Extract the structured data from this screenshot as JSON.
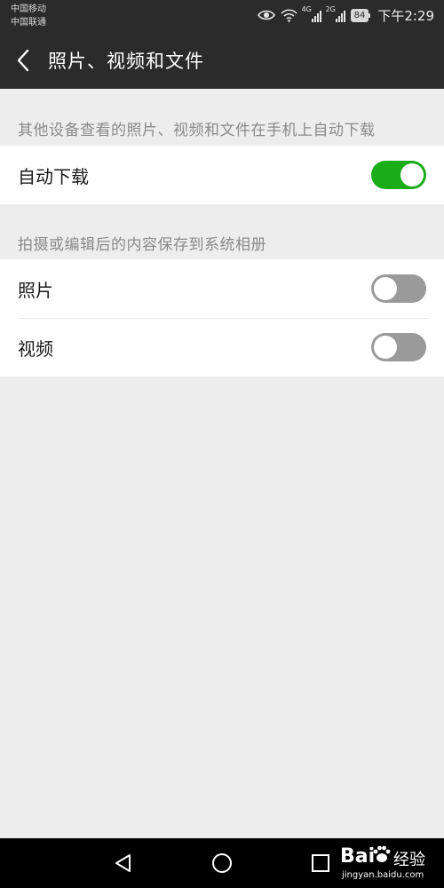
{
  "status_bar": {
    "carrier1": "中国移动",
    "carrier2": "中国联通",
    "net1": "4G",
    "net2": "2G",
    "battery": "84",
    "time": "下午2:29"
  },
  "header": {
    "title": "照片、视频和文件"
  },
  "sections": [
    {
      "caption": "其他设备查看的照片、视频和文件在手机上自动下载",
      "items": [
        {
          "label": "自动下载",
          "enabled": true
        }
      ]
    },
    {
      "caption": "拍摄或编辑后的内容保存到系统相册",
      "items": [
        {
          "label": "照片",
          "enabled": false
        },
        {
          "label": "视频",
          "enabled": false
        }
      ]
    }
  ],
  "watermark": {
    "brand_a": "Bai",
    "brand_b": "经验",
    "url": "jingyan.baidu.com"
  },
  "colors": {
    "toggle_on": "#1aad19",
    "toggle_off": "#9a9a9a",
    "bar": "#2b2b2b"
  }
}
